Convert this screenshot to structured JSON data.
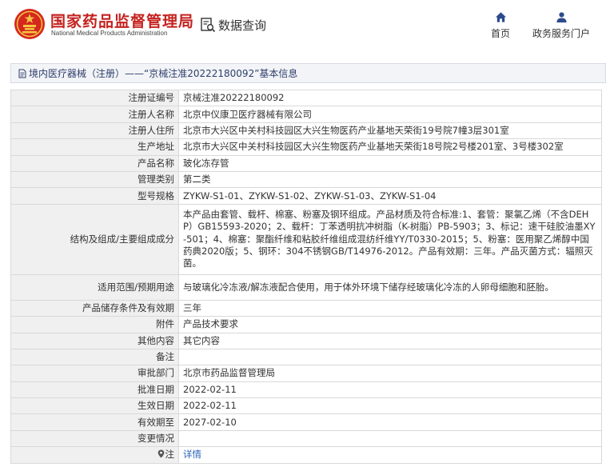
{
  "header": {
    "brand_cn": "国家药品监督管理局",
    "brand_en": "National Medical Products Administration",
    "query_label": "数据查询",
    "nav_home": "首页",
    "nav_portal": "政务服务门户"
  },
  "breadcrumb": {
    "text": "境内医疗器械（注册）——“京械注准20222180092”基本信息"
  },
  "rows": [
    {
      "label": "注册证编号",
      "value": "京械注准20222180092"
    },
    {
      "label": "注册人名称",
      "value": "北京中仪康卫医疗器械有限公司"
    },
    {
      "label": "注册人住所",
      "value": "北京市大兴区中关村科技园区大兴生物医药产业基地天荣街19号院7幢3层301室"
    },
    {
      "label": "生产地址",
      "value": "北京市大兴区中关村科技园区大兴生物医药产业基地天荣街18号院2号楼201室、3号楼302室"
    },
    {
      "label": "产品名称",
      "value": "玻化冻存管"
    },
    {
      "label": "管理类别",
      "value": "第二类"
    },
    {
      "label": "型号规格",
      "value": "ZYKW-S1-01、ZYKW-S1-02、ZYKW-S1-03、ZYKW-S1-04"
    },
    {
      "label": "结构及组成/主要组成成分",
      "value": "本产品由套管、载杆、棉塞、粉塞及钢环组成。产品材质及符合标准:1、套管：聚氯乙烯（不含DEHP）GB15593-2020；2、载杆：丁苯透明抗冲树脂（K-树脂）PB-5903；3、标记：速干硅胶油墨XY-501；4、棉塞：聚酯纤维和粘胶纤维组成混纺纤维YY/T0330-2015；5、粉塞：医用聚乙烯醇中国药典2020版；5、钢环：304不锈钢GB/T14976-2012。产品有效期：三年。产品灭菌方式：辐照灭菌。"
    },
    {
      "label": "适用范围/预期用途",
      "value": "与玻璃化冷冻液/解冻液配合使用，用于体外环境下储存经玻璃化冷冻的人卵母细胞和胚胎。"
    },
    {
      "label": "产品储存条件及有效期",
      "value": "三年"
    },
    {
      "label": "附件",
      "value": "产品技术要求"
    },
    {
      "label": "其他内容",
      "value": "其它内容"
    },
    {
      "label": "备注",
      "value": ""
    },
    {
      "label": "审批部门",
      "value": "北京市药品监督管理局"
    },
    {
      "label": "批准日期",
      "value": "2022-02-11"
    },
    {
      "label": "生效日期",
      "value": "2022-02-11"
    },
    {
      "label": "有效期至",
      "value": "2027-02-10"
    },
    {
      "label": "变更情况",
      "value": ""
    },
    {
      "label": "注",
      "value": "详情"
    }
  ],
  "colors": {
    "brand_red": "#c4221f",
    "link_blue": "#2a63b9",
    "label_bg": "#f0f0f0",
    "breadcrumb_text": "#2f3e6b"
  }
}
